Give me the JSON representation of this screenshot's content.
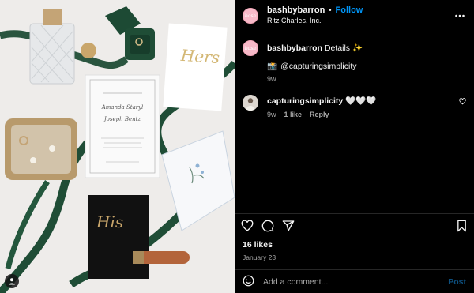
{
  "post": {
    "username": "bashbybarron",
    "separator": "•",
    "follow_label": "Follow",
    "location": "Ritz Charles, Inc.",
    "avatar_text": "bash"
  },
  "caption": {
    "username": "bashbybarron",
    "text": "Details ✨",
    "tag_emoji": "📸",
    "tag_text": "@capturingsimplicity",
    "age": "9w"
  },
  "comment": {
    "username": "capturingsimplicity",
    "text": "🤍🤍🤍",
    "age": "9w",
    "likes": "1 like",
    "reply_label": "Reply"
  },
  "stats": {
    "likes": "16 likes",
    "date": "January 23"
  },
  "add_comment": {
    "placeholder": "Add a comment...",
    "post_label": "Post"
  },
  "photo": {
    "card_name_1": "Amanda Staryl",
    "card_name_2": "Joseph Bentz",
    "hers_text": "Hers",
    "his_text": "His"
  },
  "icons": {
    "more": "more-options-icon",
    "heart": "heart-icon",
    "comment": "comment-icon",
    "share": "share-icon",
    "save": "bookmark-icon",
    "emoji": "emoji-icon",
    "tag": "user-tag-icon"
  },
  "colors": {
    "follow": "#0095f6",
    "post_disabled": "#0d4f7e",
    "muted": "#a8a8a8",
    "ribbon": "#1f4d36"
  }
}
